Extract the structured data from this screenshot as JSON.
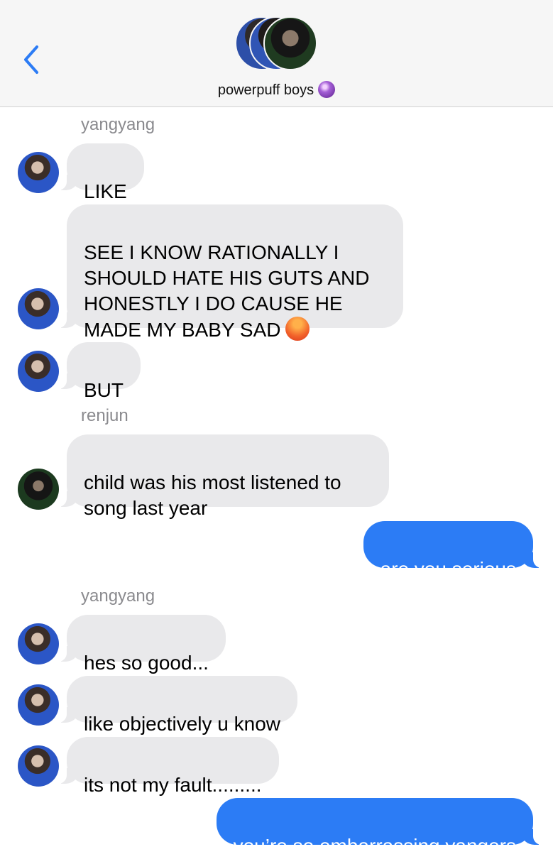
{
  "header": {
    "back_icon": "chevron-left-icon",
    "group_name": "powerpuff boys",
    "group_emoji": "crystal-ball-icon",
    "accent": "#2c7cf5"
  },
  "messages": [
    {
      "sender": "yangyang"
    },
    {
      "text": "LIKE"
    },
    {
      "text": "SEE I KNOW RATIONALLY I\nSHOULD HATE HIS GUTS AND\nHONESTLY I DO CAUSE HE\nMADE MY BABY SAD"
    },
    {
      "text": "BUT"
    },
    {
      "sender": "renjun"
    },
    {
      "text": "child was his most listened to\nsong last year"
    },
    {
      "text": "are you serious"
    },
    {
      "sender": "yangyang"
    },
    {
      "text": "hes so good..."
    },
    {
      "text": "like objectively u know"
    },
    {
      "text": "its not my fault........."
    },
    {
      "text": "you’re so embarrassing yangers"
    }
  ],
  "colors": {
    "incoming_bubble": "#e9e9eb",
    "outgoing_bubble": "#2c7cf5",
    "sender_label": "#8a8a8e"
  }
}
